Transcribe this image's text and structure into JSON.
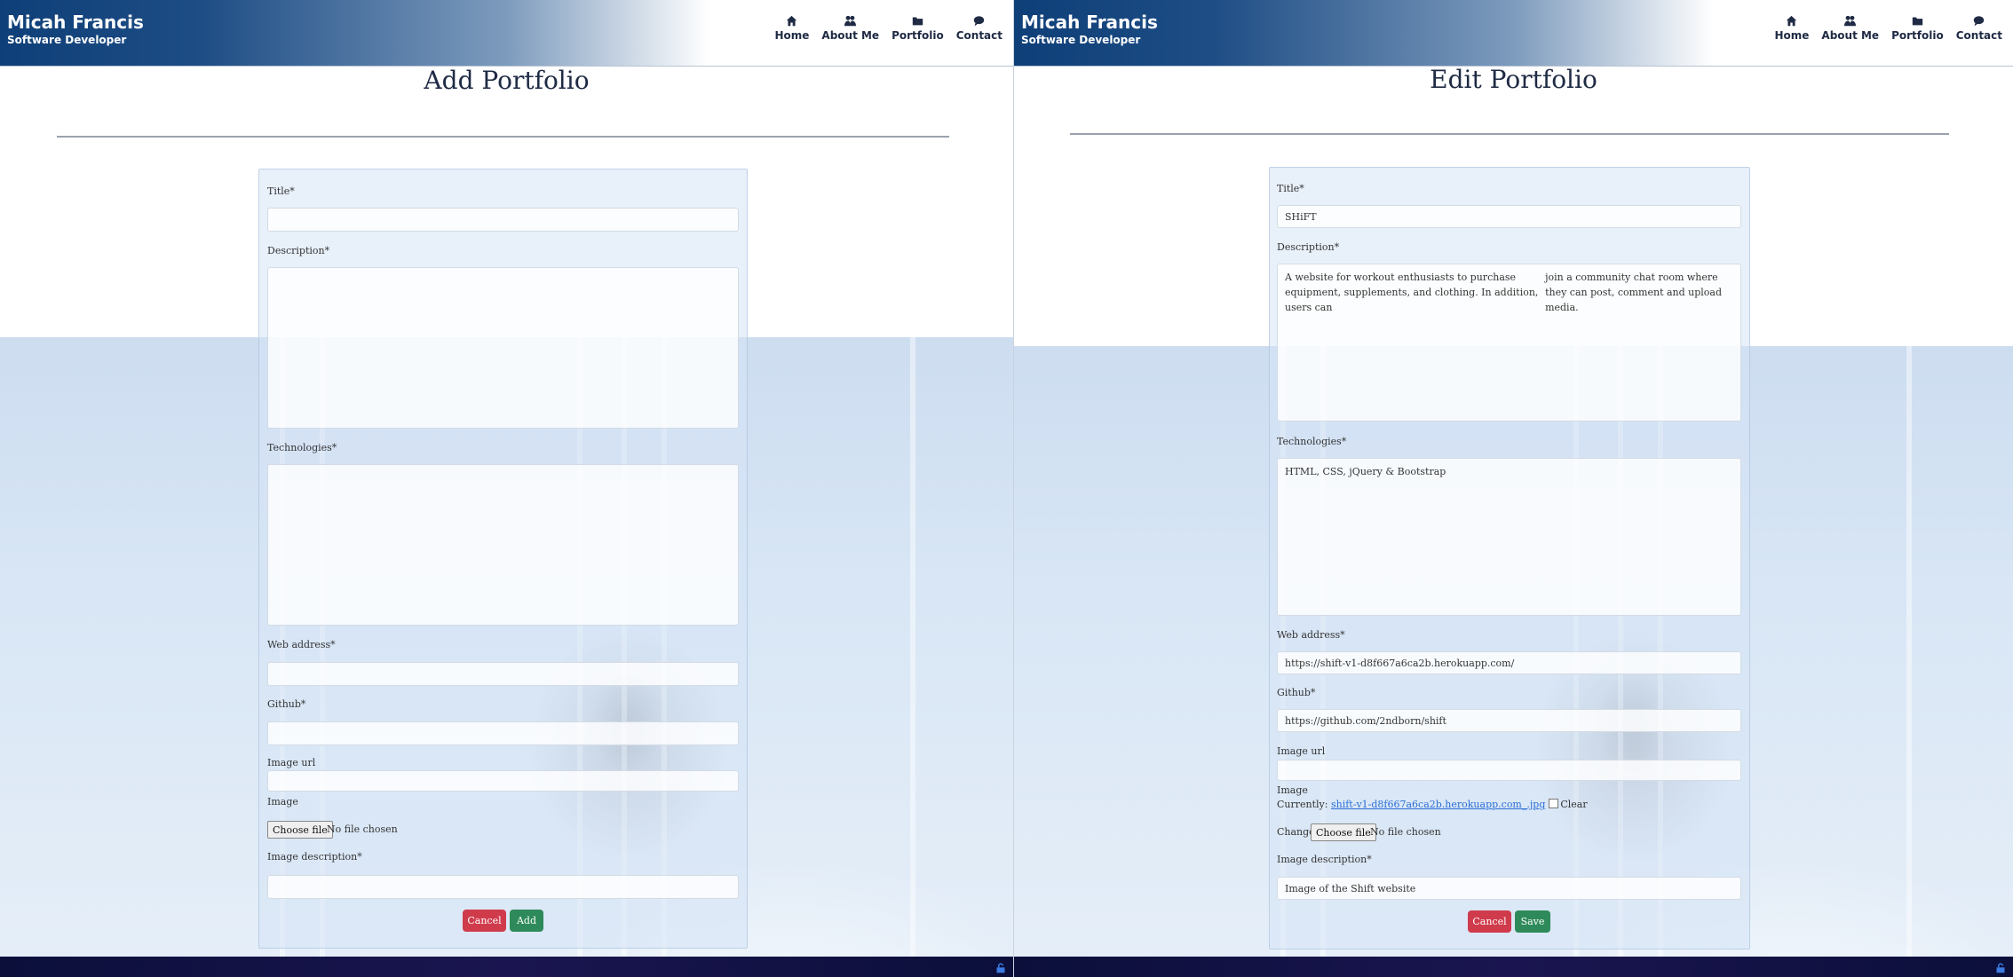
{
  "brand": {
    "name": "Micah Francis",
    "subtitle": "Software Developer"
  },
  "nav": [
    {
      "label": "Home",
      "icon": "home-icon"
    },
    {
      "label": "About Me",
      "icon": "user-tie-icon"
    },
    {
      "label": "Portfolio",
      "icon": "folder-icon"
    },
    {
      "label": "Contact",
      "icon": "comment-icon"
    }
  ],
  "add_form": {
    "page_title": "Add Portfolio",
    "title_label": "Title*",
    "title_value": "",
    "description_label": "Description*",
    "description_value": "",
    "technologies_label": "Technologies*",
    "technologies_value": "",
    "web_address_label": "Web address*",
    "web_address_value": "",
    "github_label": "Github*",
    "github_value": "",
    "image_url_label": "Image url",
    "image_url_value": "",
    "image_label": "Image",
    "choose_file_label": "Choose file",
    "no_file_text": "No file chosen",
    "image_description_label": "Image description*",
    "image_description_value": "",
    "cancel_label": "Cancel",
    "submit_label": "Add"
  },
  "edit_form": {
    "page_title": "Edit Portfolio",
    "title_label": "Title*",
    "title_value": "SHiFT",
    "description_label": "Description*",
    "description_line1": "A website for workout enthusiasts to purchase equipment, supplements, and clothing. In addition, users can",
    "description_line2": "join a community chat room where they can post, comment and upload media.",
    "technologies_label": "Technologies*",
    "technologies_value": "HTML, CSS, jQuery & Bootstrap",
    "web_address_label": "Web address*",
    "web_address_value": "https://shift-v1-d8f667a6ca2b.herokuapp.com/",
    "github_label": "Github*",
    "github_value": "https://github.com/2ndborn/shift",
    "image_url_label": "Image url",
    "image_url_value": "",
    "image_label": "Image",
    "currently_label": "Currently:",
    "current_file": "shift-v1-d8f667a6ca2b.herokuapp.com_.jpg",
    "clear_label": "Clear",
    "change_label": "Change:",
    "choose_file_label": "Choose file",
    "no_file_text": "No file chosen",
    "image_description_label": "Image description*",
    "image_description_value": "Image of the Shift website",
    "cancel_label": "Cancel",
    "submit_label": "Save"
  },
  "colors": {
    "nav_blue": "#0f3f78",
    "cancel_red": "#d03b4c",
    "submit_green": "#2e8a5a",
    "footer_navy": "#0b0f3a",
    "link_blue": "#2b6fd6"
  }
}
